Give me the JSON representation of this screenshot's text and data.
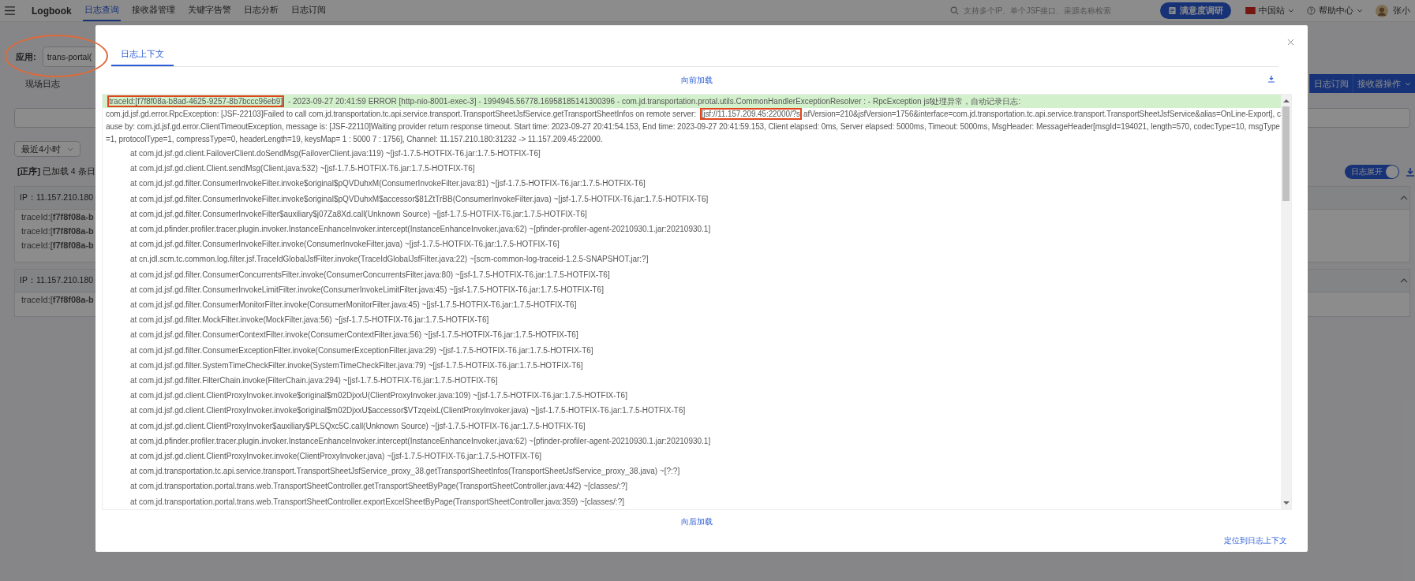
{
  "topbar": {
    "brand": "Logbook",
    "tabs": [
      {
        "label": "日志查询",
        "selected": true
      },
      {
        "label": "接收器管理",
        "selected": false
      },
      {
        "label": "关键字告警",
        "selected": false
      },
      {
        "label": "日志分析",
        "selected": false
      },
      {
        "label": "日志订阅",
        "selected": false
      }
    ],
    "search": {
      "placeholder": "支持多个IP、单个JSF接口、采源名称检索"
    },
    "survey_button": "满意度调研",
    "region": "中国站",
    "help": "帮助中心",
    "user": "张小"
  },
  "filters": {
    "app_label": "应用:",
    "app_value": "trans-portal(",
    "time_range": "最近4小时"
  },
  "view_tab": "现场日志",
  "actions": [
    {
      "label": "日志订阅",
      "dropdown": false
    },
    {
      "label": "接收器操作",
      "dropdown": true
    }
  ],
  "status": "**[正序]** 已加载 4 条日",
  "expand_toggle": {
    "label": "日志展开",
    "on": true
  },
  "log_groups": [
    {
      "ip": "IP：11.157.210.180",
      "expanded": true,
      "entries": [
        "traceId:[**f7f8f08a-b**",
        "traceId:[**f7f8f08a-b**",
        "traceId:[**f7f8f08a-b**"
      ]
    },
    {
      "ip": "IP：11.157.210.180",
      "expanded": true,
      "entries": [
        "traceId:[**f7f8f08a-b**"
      ]
    }
  ],
  "modal": {
    "tabs": [
      {
        "label": "日志上下文",
        "selected": true
      }
    ],
    "load_earlier": "向前加载",
    "load_later": "向后加载",
    "locate_link": "定位到日志上下文",
    "lines": [
      {
        "kind": "match",
        "parts": [
          {
            "text": "traceId:[f7f8f08a-b8ad-4625-9257-8b7bccc96eb9]",
            "callout": true
          },
          {
            "text": " - 2023-09-27 20:41:59 ERROR [http-nio-8001-exec-3] - 1994945.56778.16958185141300396 - com.jd.transportation.protal.utils.CommonHandlerExceptionResolver : - RpcException jsf处理异常，自动记录日志:",
            "callout": false
          }
        ]
      },
      {
        "kind": "message",
        "parts": [
          {
            "text": "com.jd.jsf.gd.error.RpcException: [JSF-22103]Failed to call com.jd.transportation.tc.api.service.transport.TransportSheetJsfService.getTransportSheetInfos on remote server: ",
            "callout": false
          },
          {
            "text": "[jsf://11.157.209.45:22000/?s",
            "callout": true
          },
          {
            "text": "afVersion=210&jsfVersion=1756&interface=com.jd.transportation.tc.api.service.transport.TransportSheetJsfService&alias=OnLine-Export], cause by: com.jd.jsf.gd.error.ClientTimeoutException, message is: [JSF-22110]Waiting provider return response timeout. Start time: 2023-09-27 20:41:54.153, End time: 2023-09-27 20:41:59.153, Client elapsed: 0ms, Server elapsed: 5000ms, Timeout: 5000ms, MsgHeader: MessageHeader[msgId=194021, length=570, codecType=10, msgType=1, protocolType=1, compressType=0, headerLength=19, keysMap= 1 : 5000 7 : 1756], Channel: 11.157.210.180:31232 -> 11.157.209.45:22000.",
            "callout": false
          }
        ]
      },
      {
        "kind": "frame",
        "text": "at com.jd.jsf.gd.client.FailoverClient.doSendMsg(FailoverClient.java:119) ~[jsf-1.7.5-HOTFIX-T6.jar:1.7.5-HOTFIX-T6]"
      },
      {
        "kind": "frame",
        "text": "at com.jd.jsf.gd.client.Client.sendMsg(Client.java:532) ~[jsf-1.7.5-HOTFIX-T6.jar:1.7.5-HOTFIX-T6]"
      },
      {
        "kind": "frame",
        "text": "at com.jd.jsf.gd.filter.ConsumerInvokeFilter.invoke$original$pQVDuhxM(ConsumerInvokeFilter.java:81) ~[jsf-1.7.5-HOTFIX-T6.jar:1.7.5-HOTFIX-T6]"
      },
      {
        "kind": "frame",
        "text": "at com.jd.jsf.gd.filter.ConsumerInvokeFilter.invoke$original$pQVDuhxM$accessor$81ZtTrBB(ConsumerInvokeFilter.java) ~[jsf-1.7.5-HOTFIX-T6.jar:1.7.5-HOTFIX-T6]"
      },
      {
        "kind": "frame",
        "text": "at com.jd.jsf.gd.filter.ConsumerInvokeFilter$auxiliary$j07Za8Xd.call(Unknown Source) ~[jsf-1.7.5-HOTFIX-T6.jar:1.7.5-HOTFIX-T6]"
      },
      {
        "kind": "frame",
        "text": "at com.jd.pfinder.profiler.tracer.plugin.invoker.InstanceEnhanceInvoker.intercept(InstanceEnhanceInvoker.java:62) ~[pfinder-profiler-agent-20210930.1.jar:20210930.1]"
      },
      {
        "kind": "frame",
        "text": "at com.jd.jsf.gd.filter.ConsumerInvokeFilter.invoke(ConsumerInvokeFilter.java) ~[jsf-1.7.5-HOTFIX-T6.jar:1.7.5-HOTFIX-T6]"
      },
      {
        "kind": "frame",
        "text": "at cn.jdl.scm.tc.common.log.filter.jsf.TraceIdGlobalJsfFilter.invoke(TraceIdGlobalJsfFilter.java:22) ~[scm-common-log-traceid-1.2.5-SNAPSHOT.jar:?]"
      },
      {
        "kind": "frame",
        "text": "at com.jd.jsf.gd.filter.ConsumerConcurrentsFilter.invoke(ConsumerConcurrentsFilter.java:80) ~[jsf-1.7.5-HOTFIX-T6.jar:1.7.5-HOTFIX-T6]"
      },
      {
        "kind": "frame",
        "text": "at com.jd.jsf.gd.filter.ConsumerInvokeLimitFilter.invoke(ConsumerInvokeLimitFilter.java:45) ~[jsf-1.7.5-HOTFIX-T6.jar:1.7.5-HOTFIX-T6]"
      },
      {
        "kind": "frame",
        "text": "at com.jd.jsf.gd.filter.ConsumerMonitorFilter.invoke(ConsumerMonitorFilter.java:45) ~[jsf-1.7.5-HOTFIX-T6.jar:1.7.5-HOTFIX-T6]"
      },
      {
        "kind": "frame",
        "text": "at com.jd.jsf.gd.filter.MockFilter.invoke(MockFilter.java:56) ~[jsf-1.7.5-HOTFIX-T6.jar:1.7.5-HOTFIX-T6]"
      },
      {
        "kind": "frame",
        "text": "at com.jd.jsf.gd.filter.ConsumerContextFilter.invoke(ConsumerContextFilter.java:56) ~[jsf-1.7.5-HOTFIX-T6.jar:1.7.5-HOTFIX-T6]"
      },
      {
        "kind": "frame",
        "text": "at com.jd.jsf.gd.filter.ConsumerExceptionFilter.invoke(ConsumerExceptionFilter.java:29) ~[jsf-1.7.5-HOTFIX-T6.jar:1.7.5-HOTFIX-T6]"
      },
      {
        "kind": "frame",
        "text": "at com.jd.jsf.gd.filter.SystemTimeCheckFilter.invoke(SystemTimeCheckFilter.java:79) ~[jsf-1.7.5-HOTFIX-T6.jar:1.7.5-HOTFIX-T6]"
      },
      {
        "kind": "frame",
        "text": "at com.jd.jsf.gd.filter.FilterChain.invoke(FilterChain.java:294) ~[jsf-1.7.5-HOTFIX-T6.jar:1.7.5-HOTFIX-T6]"
      },
      {
        "kind": "frame",
        "text": "at com.jd.jsf.gd.client.ClientProxyInvoker.invoke$original$m02DjxxU(ClientProxyInvoker.java:109) ~[jsf-1.7.5-HOTFIX-T6.jar:1.7.5-HOTFIX-T6]"
      },
      {
        "kind": "frame",
        "text": "at com.jd.jsf.gd.client.ClientProxyInvoker.invoke$original$m02DjxxU$accessor$VTzqeixL(ClientProxyInvoker.java) ~[jsf-1.7.5-HOTFIX-T6.jar:1.7.5-HOTFIX-T6]"
      },
      {
        "kind": "frame",
        "text": "at com.jd.jsf.gd.client.ClientProxyInvoker$auxiliary$PLSQxc5C.call(Unknown Source) ~[jsf-1.7.5-HOTFIX-T6.jar:1.7.5-HOTFIX-T6]"
      },
      {
        "kind": "frame",
        "text": "at com.jd.pfinder.profiler.tracer.plugin.invoker.InstanceEnhanceInvoker.intercept(InstanceEnhanceInvoker.java:62) ~[pfinder-profiler-agent-20210930.1.jar:20210930.1]"
      },
      {
        "kind": "frame",
        "text": "at com.jd.jsf.gd.client.ClientProxyInvoker.invoke(ClientProxyInvoker.java) ~[jsf-1.7.5-HOTFIX-T6.jar:1.7.5-HOTFIX-T6]"
      },
      {
        "kind": "frame",
        "text": "at com.jd.transportation.tc.api.service.transport.TransportSheetJsfService_proxy_38.getTransportSheetInfos(TransportSheetJsfService_proxy_38.java) ~[?:?]"
      },
      {
        "kind": "frame",
        "text": "at com.jd.transportation.portal.trans.web.TransportSheetController.getTransportSheetByPage(TransportSheetController.java:442) ~[classes/:?]"
      },
      {
        "kind": "frame",
        "text": "at com.jd.transportation.portal.trans.web.TransportSheetController.exportExcelSheetByPage(TransportSheetController.java:359) ~[classes/:?]"
      }
    ]
  }
}
